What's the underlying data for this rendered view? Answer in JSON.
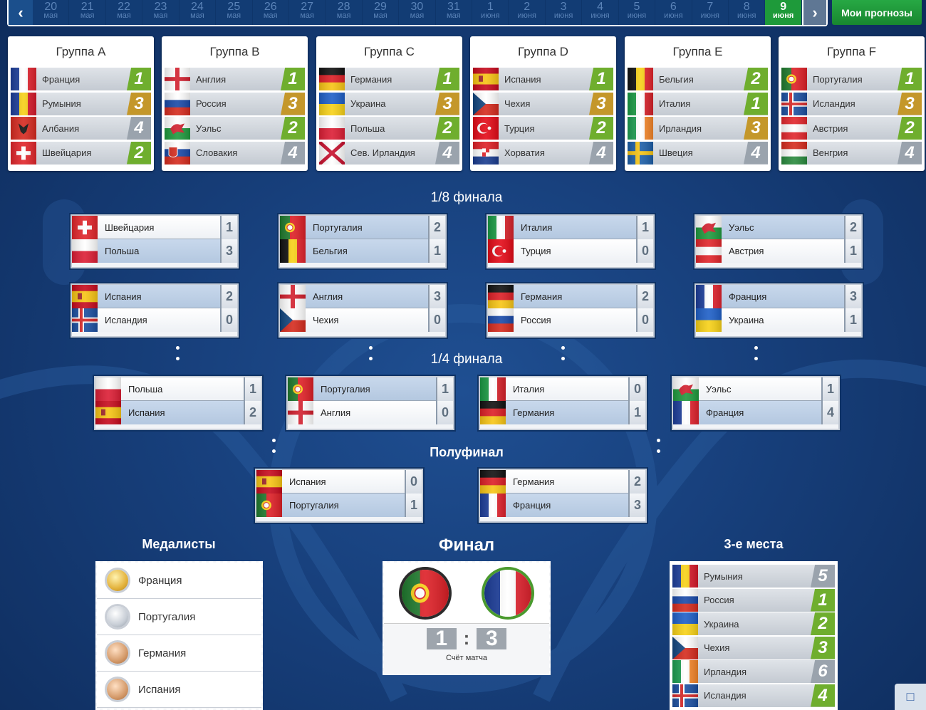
{
  "dates": [
    {
      "d": "20",
      "m": "мая"
    },
    {
      "d": "21",
      "m": "мая"
    },
    {
      "d": "22",
      "m": "мая"
    },
    {
      "d": "23",
      "m": "мая"
    },
    {
      "d": "24",
      "m": "мая"
    },
    {
      "d": "25",
      "m": "мая"
    },
    {
      "d": "26",
      "m": "мая"
    },
    {
      "d": "27",
      "m": "мая"
    },
    {
      "d": "28",
      "m": "мая"
    },
    {
      "d": "29",
      "m": "мая"
    },
    {
      "d": "30",
      "m": "мая"
    },
    {
      "d": "31",
      "m": "мая"
    },
    {
      "d": "1",
      "m": "июня"
    },
    {
      "d": "2",
      "m": "июня"
    },
    {
      "d": "3",
      "m": "июня"
    },
    {
      "d": "4",
      "m": "июня"
    },
    {
      "d": "5",
      "m": "июня"
    },
    {
      "d": "6",
      "m": "июня"
    },
    {
      "d": "7",
      "m": "июня"
    },
    {
      "d": "8",
      "m": "июня"
    },
    {
      "d": "9",
      "m": "июня",
      "active": true
    }
  ],
  "nav": {
    "prev_icon": "chevron-left-icon",
    "next_icon": "chevron-right-icon",
    "my_predictions": "Мои прогнозы"
  },
  "colors": {
    "green": "#6fae2e",
    "gold": "#c4972a",
    "gray": "#9aa3ad",
    "active_date": "#1e9a3a"
  },
  "groups": [
    {
      "title": "Группа A",
      "teams": [
        {
          "name": "Франция",
          "flag": "fra",
          "pos": "1",
          "c": "g"
        },
        {
          "name": "Румыния",
          "flag": "rou",
          "pos": "3",
          "c": "o"
        },
        {
          "name": "Албания",
          "flag": "alb",
          "pos": "4",
          "c": "s"
        },
        {
          "name": "Швейцария",
          "flag": "sui",
          "pos": "2",
          "c": "g"
        }
      ]
    },
    {
      "title": "Группа B",
      "teams": [
        {
          "name": "Англия",
          "flag": "eng",
          "pos": "1",
          "c": "g"
        },
        {
          "name": "Россия",
          "flag": "rus",
          "pos": "3",
          "c": "o"
        },
        {
          "name": "Уэльс",
          "flag": "wal",
          "pos": "2",
          "c": "g"
        },
        {
          "name": "Словакия",
          "flag": "svk",
          "pos": "4",
          "c": "s"
        }
      ]
    },
    {
      "title": "Группа C",
      "teams": [
        {
          "name": "Германия",
          "flag": "ger",
          "pos": "1",
          "c": "g"
        },
        {
          "name": "Украина",
          "flag": "ukr",
          "pos": "3",
          "c": "o"
        },
        {
          "name": "Польша",
          "flag": "pol",
          "pos": "2",
          "c": "g"
        },
        {
          "name": "Сев. Ирландия",
          "flag": "nir",
          "pos": "4",
          "c": "s"
        }
      ]
    },
    {
      "title": "Группа D",
      "teams": [
        {
          "name": "Испания",
          "flag": "esp",
          "pos": "1",
          "c": "g"
        },
        {
          "name": "Чехия",
          "flag": "cze",
          "pos": "3",
          "c": "o"
        },
        {
          "name": "Турция",
          "flag": "tur",
          "pos": "2",
          "c": "g"
        },
        {
          "name": "Хорватия",
          "flag": "cro",
          "pos": "4",
          "c": "s"
        }
      ]
    },
    {
      "title": "Группа E",
      "teams": [
        {
          "name": "Бельгия",
          "flag": "bel",
          "pos": "2",
          "c": "g"
        },
        {
          "name": "Италия",
          "flag": "ita",
          "pos": "1",
          "c": "g"
        },
        {
          "name": "Ирландия",
          "flag": "irl",
          "pos": "3",
          "c": "o"
        },
        {
          "name": "Швеция",
          "flag": "swe",
          "pos": "4",
          "c": "s"
        }
      ]
    },
    {
      "title": "Группа F",
      "teams": [
        {
          "name": "Португалия",
          "flag": "por",
          "pos": "1",
          "c": "g"
        },
        {
          "name": "Исландия",
          "flag": "isl",
          "pos": "3",
          "c": "o"
        },
        {
          "name": "Австрия",
          "flag": "aut",
          "pos": "2",
          "c": "g"
        },
        {
          "name": "Венгрия",
          "flag": "hun",
          "pos": "4",
          "c": "s"
        }
      ]
    }
  ],
  "titles": {
    "r16": "1/8 финала",
    "qf": "1/4 финала",
    "sf": "Полуфинал",
    "medalists": "Медалисты",
    "final": "Финал",
    "third": "3-е места"
  },
  "r16": [
    [
      {
        "name": "Швейцария",
        "flag": "sui",
        "score": "1"
      },
      {
        "name": "Польша",
        "flag": "pol",
        "score": "3",
        "hi": true
      }
    ],
    [
      {
        "name": "Португалия",
        "flag": "por",
        "score": "2",
        "hi": true
      },
      {
        "name": "Бельгия",
        "flag": "bel",
        "score": "1",
        "hi": true
      }
    ],
    [
      {
        "name": "Италия",
        "flag": "ita",
        "score": "1",
        "hi": true
      },
      {
        "name": "Турция",
        "flag": "tur",
        "score": "0"
      }
    ],
    [
      {
        "name": "Уэльс",
        "flag": "wal",
        "score": "2",
        "hi": true
      },
      {
        "name": "Австрия",
        "flag": "aut",
        "score": "1"
      }
    ],
    [
      {
        "name": "Испания",
        "flag": "esp",
        "score": "2",
        "hi": true
      },
      {
        "name": "Исландия",
        "flag": "isl",
        "score": "0"
      }
    ],
    [
      {
        "name": "Англия",
        "flag": "eng",
        "score": "3",
        "hi": true
      },
      {
        "name": "Чехия",
        "flag": "cze",
        "score": "0"
      }
    ],
    [
      {
        "name": "Германия",
        "flag": "ger",
        "score": "2",
        "hi": true
      },
      {
        "name": "Россия",
        "flag": "rus",
        "score": "0"
      }
    ],
    [
      {
        "name": "Франция",
        "flag": "fra",
        "score": "3",
        "hi": true
      },
      {
        "name": "Украина",
        "flag": "ukr",
        "score": "1"
      }
    ]
  ],
  "qf": [
    [
      {
        "name": "Польша",
        "flag": "pol",
        "score": "1"
      },
      {
        "name": "Испания",
        "flag": "esp",
        "score": "2",
        "hi": true
      }
    ],
    [
      {
        "name": "Португалия",
        "flag": "por",
        "score": "1",
        "hi": true
      },
      {
        "name": "Англия",
        "flag": "eng",
        "score": "0"
      }
    ],
    [
      {
        "name": "Италия",
        "flag": "ita",
        "score": "0"
      },
      {
        "name": "Германия",
        "flag": "ger",
        "score": "1",
        "hi": true
      }
    ],
    [
      {
        "name": "Уэльс",
        "flag": "wal",
        "score": "1"
      },
      {
        "name": "Франция",
        "flag": "fra",
        "score": "4",
        "hi": true
      }
    ]
  ],
  "sf": [
    [
      {
        "name": "Испания",
        "flag": "esp",
        "score": "0"
      },
      {
        "name": "Португалия",
        "flag": "por",
        "score": "1",
        "hi": true
      }
    ],
    [
      {
        "name": "Германия",
        "flag": "ger",
        "score": "2"
      },
      {
        "name": "Франция",
        "flag": "fra",
        "score": "3",
        "hi": true
      }
    ]
  ],
  "medalists": [
    {
      "name": "Франция",
      "medal": "gold"
    },
    {
      "name": "Португалия",
      "medal": "silver"
    },
    {
      "name": "Германия",
      "medal": "bronze"
    },
    {
      "name": "Испания",
      "medal": "bronze"
    }
  ],
  "final": {
    "home_flag": "por",
    "away_flag": "fra",
    "home_score": "1",
    "away_score": "3",
    "label": "Счёт матча"
  },
  "third": [
    {
      "name": "Румыния",
      "flag": "rou",
      "pos": "5",
      "c": "s"
    },
    {
      "name": "Россия",
      "flag": "rus",
      "pos": "1",
      "c": "g"
    },
    {
      "name": "Украина",
      "flag": "ukr",
      "pos": "2",
      "c": "g"
    },
    {
      "name": "Чехия",
      "flag": "cze",
      "pos": "3",
      "c": "g"
    },
    {
      "name": "Ирландия",
      "flag": "irl",
      "pos": "6",
      "c": "s"
    },
    {
      "name": "Исландия",
      "flag": "isl",
      "pos": "4",
      "c": "g"
    }
  ]
}
